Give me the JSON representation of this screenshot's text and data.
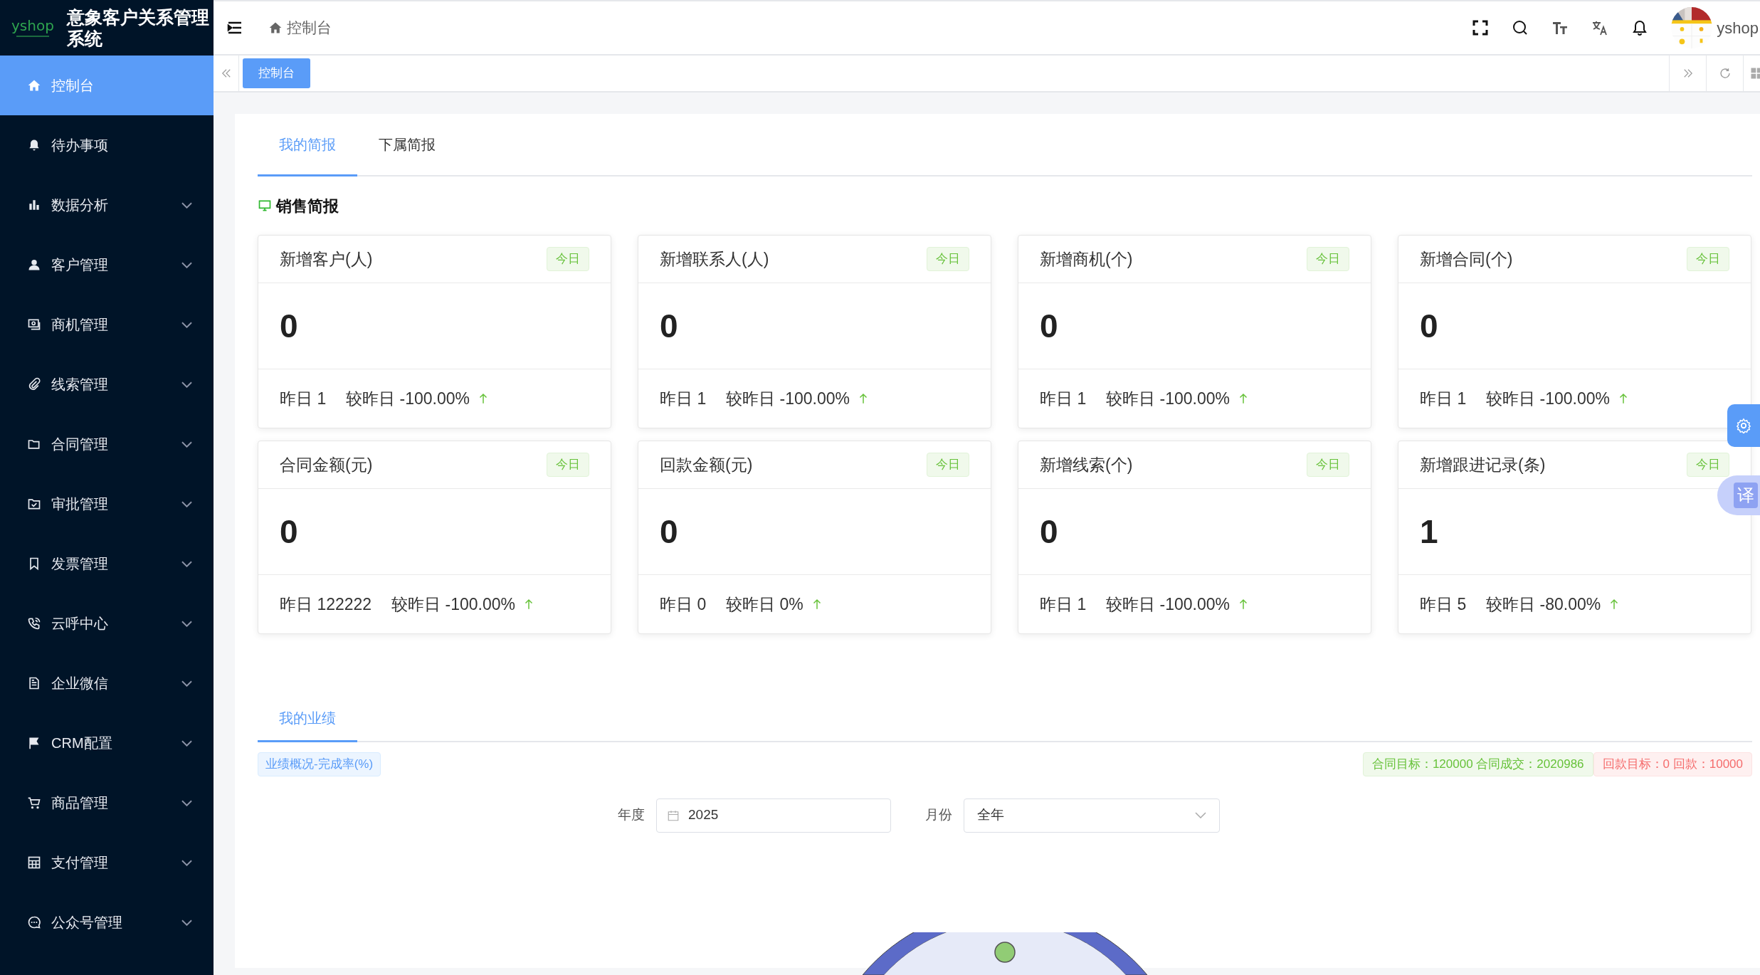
{
  "brand": {
    "logo_text": "yshop",
    "title": "意象客户关系管理系统"
  },
  "sidebar": {
    "items": [
      {
        "label": "控制台",
        "expandable": false,
        "selected": true
      },
      {
        "label": "待办事项",
        "expandable": false,
        "selected": false
      },
      {
        "label": "数据分析",
        "expandable": true,
        "selected": false
      },
      {
        "label": "客户管理",
        "expandable": true,
        "selected": false
      },
      {
        "label": "商机管理",
        "expandable": true,
        "selected": false
      },
      {
        "label": "线索管理",
        "expandable": true,
        "selected": false
      },
      {
        "label": "合同管理",
        "expandable": true,
        "selected": false
      },
      {
        "label": "审批管理",
        "expandable": true,
        "selected": false
      },
      {
        "label": "发票管理",
        "expandable": true,
        "selected": false
      },
      {
        "label": "云呼中心",
        "expandable": true,
        "selected": false
      },
      {
        "label": "企业微信",
        "expandable": true,
        "selected": false
      },
      {
        "label": "CRM配置",
        "expandable": true,
        "selected": false
      },
      {
        "label": "商品管理",
        "expandable": true,
        "selected": false
      },
      {
        "label": "支付管理",
        "expandable": true,
        "selected": false
      },
      {
        "label": "公众号管理",
        "expandable": true,
        "selected": false
      }
    ]
  },
  "header": {
    "breadcrumb": "控制台",
    "user": "yshop"
  },
  "page_tabs": [
    {
      "label": "控制台",
      "selected": true
    }
  ],
  "report_tabs": [
    {
      "label": "我的简报",
      "selected": true
    },
    {
      "label": "下属简报",
      "selected": false
    }
  ],
  "section_title": "销售简报",
  "cards": [
    {
      "title": "新增客户(人)",
      "badge": "今日",
      "value": "0",
      "yesterday": "昨日 1",
      "compare": "较昨日 -100.00%"
    },
    {
      "title": "新增联系人(人)",
      "badge": "今日",
      "value": "0",
      "yesterday": "昨日 1",
      "compare": "较昨日 -100.00%"
    },
    {
      "title": "新增商机(个)",
      "badge": "今日",
      "value": "0",
      "yesterday": "昨日 1",
      "compare": "较昨日 -100.00%"
    },
    {
      "title": "新增合同(个)",
      "badge": "今日",
      "value": "0",
      "yesterday": "昨日 1",
      "compare": "较昨日 -100.00%"
    },
    {
      "title": "合同金额(元)",
      "badge": "今日",
      "value": "0",
      "yesterday": "昨日 122222",
      "compare": "较昨日 -100.00%"
    },
    {
      "title": "回款金额(元)",
      "badge": "今日",
      "value": "0",
      "yesterday": "昨日 0",
      "compare": "较昨日 0%"
    },
    {
      "title": "新增线索(个)",
      "badge": "今日",
      "value": "0",
      "yesterday": "昨日 1",
      "compare": "较昨日 -100.00%"
    },
    {
      "title": "新增跟进记录(条)",
      "badge": "今日",
      "value": "1",
      "yesterday": "昨日 5",
      "compare": "较昨日 -80.00%"
    }
  ],
  "performance": {
    "tabs": [
      {
        "label": "我的业绩",
        "selected": true
      }
    ],
    "tag": "业绩概况-完成率(%)",
    "stats": [
      {
        "text": "合同目标：120000 合同成交：2020986",
        "kind": "success"
      },
      {
        "text": "回款目标：0 回款：10000",
        "kind": "danger"
      }
    ],
    "year": {
      "label": "年度",
      "value": "2025"
    },
    "month": {
      "label": "月份",
      "value": "全年"
    }
  },
  "floating": {
    "translate": "译"
  }
}
